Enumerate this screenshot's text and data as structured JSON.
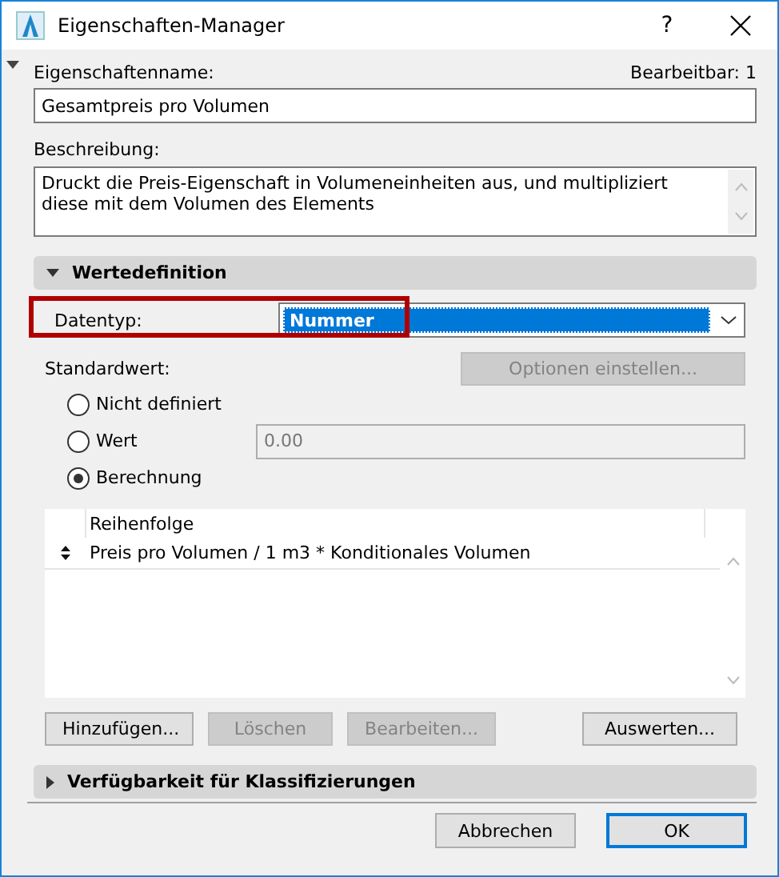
{
  "window": {
    "title": "Eigenschaften-Manager",
    "help": "?"
  },
  "name_field": {
    "label": "Eigenschaftenname:",
    "value": "Gesamtpreis pro Volumen"
  },
  "editable": "Bearbeitbar: 1",
  "description": {
    "label": "Beschreibung:",
    "value": "Druckt die Preis-Eigenschaft in Volumeneinheiten aus, und multipliziert diese mit dem Volumen des Elements"
  },
  "sections": [
    {
      "title": "Wertedefinition",
      "expanded": true
    },
    {
      "title": "Verfügbarkeit für Klassifizierungen",
      "expanded": false
    }
  ],
  "datatype": {
    "label": "Datentyp:",
    "value": "Nummer",
    "highlighted": true
  },
  "default_value": {
    "label": "Standardwert:",
    "options_button": {
      "label": "Optionen einstellen...",
      "disabled": true
    }
  },
  "radios": [
    {
      "label": "Nicht definiert",
      "selected": false
    },
    {
      "label": "Wert",
      "selected": false,
      "field": "0.00"
    },
    {
      "label": "Berechnung",
      "selected": true
    }
  ],
  "list": {
    "column": "Reihenfolge",
    "rows": [
      "Preis pro Volumen / 1 m3 * Konditionales Volumen"
    ]
  },
  "list_buttons": [
    {
      "label": "Hinzufügen...",
      "disabled": false
    },
    {
      "label": "Löschen",
      "disabled": true
    },
    {
      "label": "Bearbeiten...",
      "disabled": true
    },
    {
      "label": "Auswerten...",
      "disabled": false
    }
  ],
  "footer_buttons": [
    {
      "label": "Abbrechen",
      "default": false
    },
    {
      "label": "OK",
      "default": true
    }
  ]
}
